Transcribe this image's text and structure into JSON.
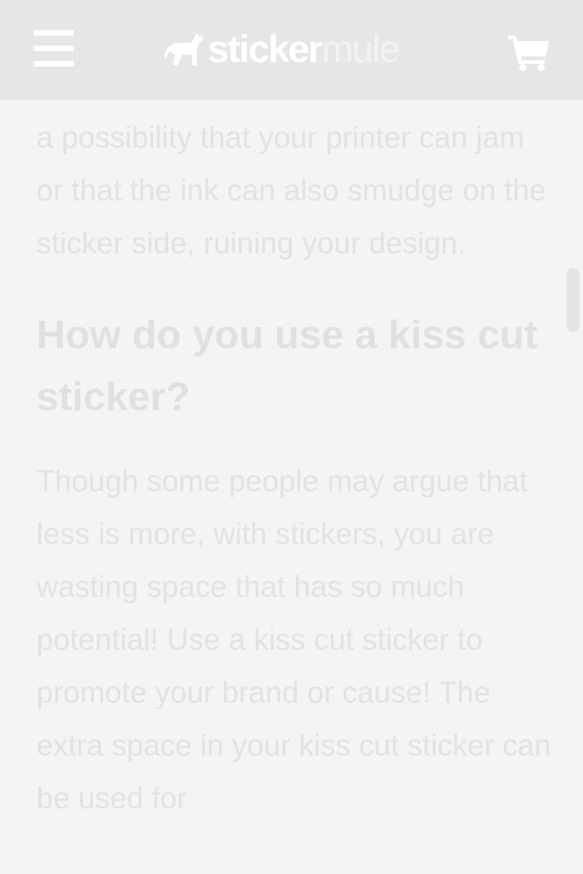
{
  "header": {
    "logo_part1": "sticker",
    "logo_part2": "mule",
    "menu_icon": "hamburger-menu-icon",
    "cart_icon": "shopping-cart-icon"
  },
  "article": {
    "paragraph1": "a possibility that your printer can jam or that the ink can also smudge on the sticker side, ruining your design.",
    "heading": "How do you use a kiss cut sticker?",
    "paragraph2": "Though some people may argue that less is more, with stickers, you are wasting space that has so much potential! Use a kiss cut sticker to promote your brand or cause! The extra space in your kiss cut sticker can be used for"
  },
  "colors": {
    "header_bg": "#e6e6e6",
    "page_bg": "#f4f4f4",
    "text": "#e2e2e2"
  }
}
